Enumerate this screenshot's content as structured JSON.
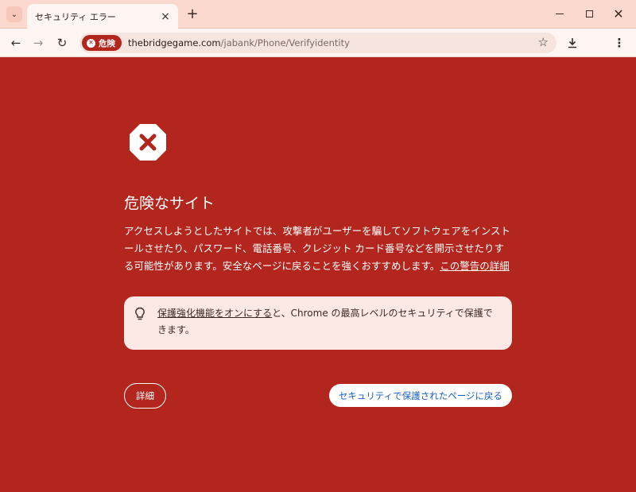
{
  "tab": {
    "title": "セキュリティ エラー",
    "close_icon": "close-icon",
    "new_tab_icon": "plus-icon"
  },
  "window_controls": {
    "minimize_icon": "minimize-icon",
    "maximize_icon": "maximize-icon",
    "close_icon": "close-icon"
  },
  "toolbar": {
    "security_chip_label": "危険",
    "url_host": "thebridgegame.com",
    "url_path": "/jabank/Phone/Verifyidentity"
  },
  "interstitial": {
    "headline": "危険なサイト",
    "explanation": "アクセスしようとしたサイトでは、攻撃者がユーザーを騙してソフトウェアをインストールさせたり、パスワード、電話番号、クレジット カード番号などを開示させたりする可能性があります。安全なページに戻ることを強くおすすめします。",
    "details_link": "この警告の詳細",
    "protection_link": "保護強化機能をオンにする",
    "protection_text": "と、Chrome の最高レベルのセキュリティで保護できます。",
    "details_button": "詳細",
    "back_button": "セキュリティで保護されたページに戻る"
  },
  "colors": {
    "danger_background": "#b3261e",
    "tab_strip": "#fcd9cf",
    "toolbar": "#fff6f3",
    "link_blue": "#1a5fc1"
  }
}
